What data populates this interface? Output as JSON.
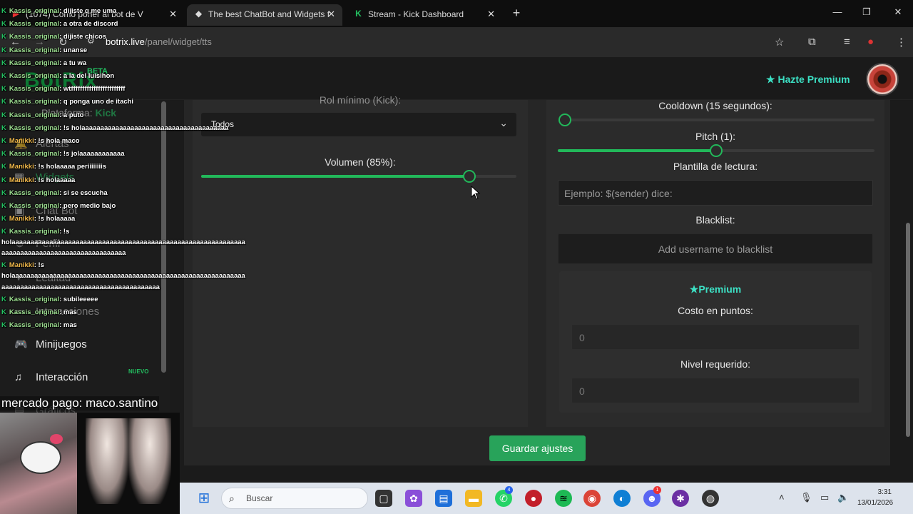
{
  "browser": {
    "tabs": [
      {
        "title": "(1074) Como poner al bot de V",
        "icon": "youtube-icon"
      },
      {
        "title": "The best ChatBot and Widgets f",
        "icon": "botrix-icon"
      },
      {
        "title": "Stream - Kick Dashboard",
        "icon": "kick-icon"
      }
    ],
    "url_host": "botrix.live",
    "url_path": "/panel/widget/tts"
  },
  "header": {
    "logo": "BotRix",
    "beta": "BETA",
    "premium_label": "Hazte Premium",
    "accent": "#3ce0c4"
  },
  "sidebar": {
    "platform_label": "Plataforma:",
    "platform_value": "Kick",
    "items": [
      {
        "label": "Alertas",
        "icon": "bell-icon"
      },
      {
        "label": "Widgets",
        "icon": "grid-icon"
      },
      {
        "label": "Chat Bot",
        "icon": "robot-icon"
      },
      {
        "label": "Perfil",
        "icon": "user-icon"
      },
      {
        "label": "Lealtad",
        "icon": "star-icon"
      },
      {
        "label": "Interacciones",
        "icon": "chat-icon"
      },
      {
        "label": "Minijuegos",
        "icon": "gamepad-icon"
      },
      {
        "label": "Interacción",
        "icon": "music-icon"
      }
    ],
    "nuevo": "NUEVO",
    "hidden_item": "Gráficos"
  },
  "left_panel": {
    "rol_label": "Rol mínimo (Kick):",
    "select_value": "Todos",
    "volume_label": "Volumen (85%):",
    "volume": 0.85
  },
  "right_panel": {
    "cooldown_label": "Cooldown (15 segundos):",
    "cooldown": 0.0,
    "pitch_label": "Pitch (1):",
    "pitch": 0.5,
    "plantilla_label": "Plantilla de lectura:",
    "plantilla_placeholder": "Ejemplo: $(sender) dice:",
    "blacklist_label": "Blacklist:",
    "blacklist_placeholder": "Add username to blacklist",
    "premium_title": "Premium",
    "costo_label": "Costo en puntos:",
    "costo_value": "0",
    "nivel_label": "Nivel requerido:",
    "nivel_value": "0"
  },
  "save_button": "Guardar ajustes",
  "chat": [
    {
      "user": "Kassis_original",
      "text": ": dijiste q me uma",
      "color": "a"
    },
    {
      "user": "Kassis_original",
      "text": ": a otra de discord",
      "color": "a"
    },
    {
      "user": "Kassis_original",
      "text": ": dijiste chicos",
      "color": "a"
    },
    {
      "user": "Kassis_original",
      "text": ": unanse",
      "color": "a"
    },
    {
      "user": "Kassis_original",
      "text": ": a tu wa",
      "color": "a"
    },
    {
      "user": "Kassis_original",
      "text": ": a la del luisihon",
      "color": "a"
    },
    {
      "user": "Kassis_original",
      "text": ": wtffffffffffffffffffffffff",
      "color": "a"
    },
    {
      "user": "Kassis_original",
      "text": ": q ponga uno de itachi",
      "color": "a"
    },
    {
      "user": "Kassis_original",
      "text": ": a puto",
      "color": "a"
    },
    {
      "user": "Kassis_original",
      "text": ": !s holaaaaaaaaaaaaaaaaaaaaaaaaaaaaaaaaaaaaaaa",
      "color": "a"
    },
    {
      "user": "Manikki",
      "text": ": !s hola maco",
      "color": "b"
    },
    {
      "user": "Kassis_original",
      "text": ": !s jolaaaaaaaaaaaa",
      "color": "a"
    },
    {
      "user": "Manikki",
      "text": ": !s holaaaaa periiiiiiiis",
      "color": "b"
    },
    {
      "user": "Manikki",
      "text": ": !s holaaaaa",
      "color": "b"
    },
    {
      "user": "Kassis_original",
      "text": ": si se escucha",
      "color": "a"
    },
    {
      "user": "Kassis_original",
      "text": ": pero medio bajo",
      "color": "a"
    },
    {
      "user": "Manikki",
      "text": ": !s holaaaaa",
      "color": "b"
    },
    {
      "user": "Kassis_original",
      "text": ": !s",
      "color": "a"
    }
  ],
  "chat_long_1a": "holaaaaaaaaaaaaaaaaaaaaaaaaaaaaaaaaaaaaaaaaaaaaaaaaaaaaaaaaaaaaaa",
  "chat_long_1b": "aaaaaaaaaaaaaaaaaaaaaaaaaaaaaaaaa",
  "chat_manikki_2": {
    "user": "Manikki",
    "text": ": !s"
  },
  "chat_long_2a": "holaaaaaaaaaaaaaaaaaaaaaaaaaaaaaaaaaaaaaaaaaaaaaaaaaaaaaaaaaaaaaa",
  "chat_long_2b": "aaaaaaaaaaaaaaaaaaaaaaaaaaaaaaaaaaaaaaaaaa",
  "chat_tail": [
    {
      "user": "Kassis_original",
      "text": ": subileeeee"
    },
    {
      "user": "Kassis_original",
      "text": ": mas"
    },
    {
      "user": "Kassis_original",
      "text": ": mas"
    }
  ],
  "donation": "mercado pago: maco.santino",
  "taskbar": {
    "search_placeholder": "Buscar",
    "time": "3:31",
    "date": "13/01/2026",
    "whatsapp_badge": "4",
    "discord_badge": "1"
  }
}
